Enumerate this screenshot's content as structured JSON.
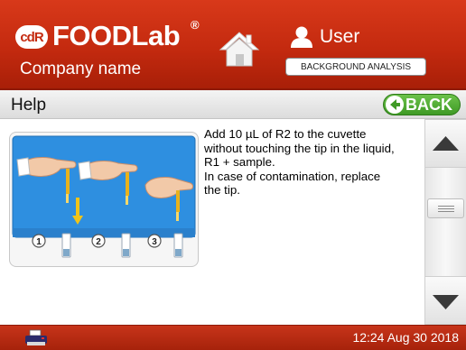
{
  "header": {
    "logo_mark": "cdR",
    "brand": "FOODLab",
    "brand_reg": "®",
    "company": "Company name",
    "user_label": "User",
    "background_button": "BACKGROUND ANALYSIS"
  },
  "titlebar": {
    "title": "Help",
    "back_label": "BACK"
  },
  "help": {
    "text": "Add  10 µL of  R2 to the cuvette\nwithout touching the tip in the liquid,\nR1 + sample.\nIn case of contamination, replace\nthe tip.",
    "step_numbers": [
      "1",
      "2",
      "3"
    ]
  },
  "footer": {
    "datetime": "12:24  Aug 30 2018"
  },
  "colors": {
    "header_red": "#c42a0f",
    "back_green": "#4aa62c",
    "illustration_blue": "#2e8fe0"
  },
  "icons": [
    "home-icon",
    "user-icon",
    "back-arrow-icon",
    "scroll-up-icon",
    "scroll-down-icon",
    "printer-icon"
  ]
}
